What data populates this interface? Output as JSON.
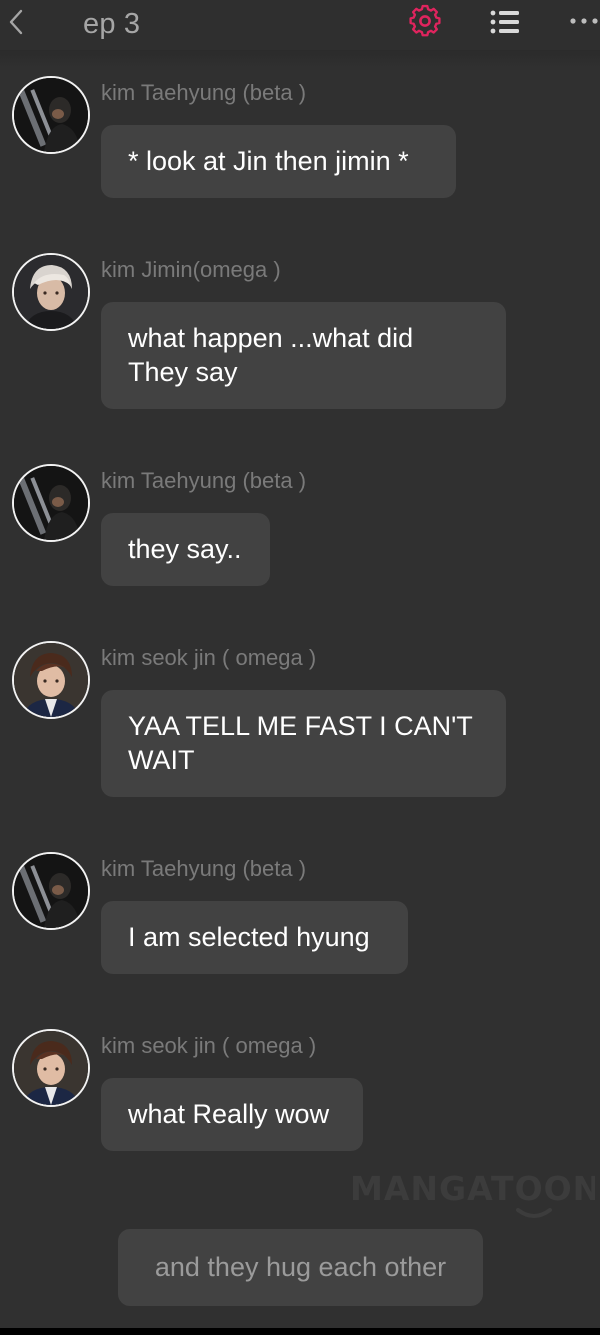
{
  "header": {
    "back_icon": "chevron-left-icon",
    "title": "ep 3",
    "settings_icon": "gear-icon",
    "list_icon": "list-icon",
    "more_icon": "more-horizontal-icon",
    "accent_color": "#e0245e"
  },
  "messages": [
    {
      "name": "kim Taehyung (beta )",
      "text": "* look at Jin then jimin *",
      "avatar": "taehyung-avatar"
    },
    {
      "name": "kim Jimin(omega )",
      "text": "what happen ...what did They say",
      "avatar": "jimin-avatar"
    },
    {
      "name": "kim Taehyung (beta )",
      "text": "they say..",
      "avatar": "taehyung-avatar"
    },
    {
      "name": "kim seok jin ( omega )",
      "text": "YAA TELL ME FAST I CAN'T WAIT",
      "avatar": "jin-avatar"
    },
    {
      "name": "kim Taehyung (beta )",
      "text": "I am selected hyung",
      "avatar": "taehyung-avatar"
    },
    {
      "name": "kim seok jin ( omega )",
      "text": "what Really wow",
      "avatar": "jin-avatar"
    }
  ],
  "narration": "and they hug each other",
  "watermark": "MANGATOON"
}
